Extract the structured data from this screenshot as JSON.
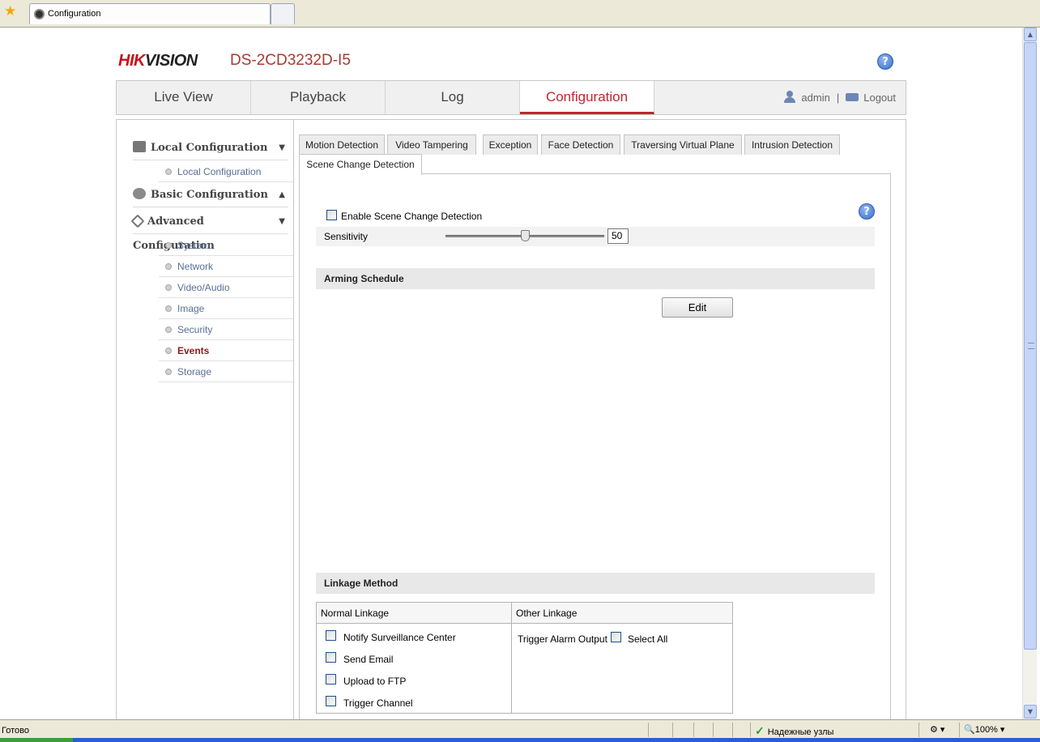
{
  "browser": {
    "tab_title": "Configuration",
    "status_text": "Готово",
    "zone_label": "Надежные узлы",
    "zoom_label": "100%"
  },
  "header": {
    "logo_hik": "HIK",
    "logo_vision": "VISION",
    "model": "DS-2CD3232D-I5",
    "help": "?"
  },
  "nav": {
    "tabs": [
      "Live View",
      "Playback",
      "Log",
      "Configuration"
    ],
    "active": "Configuration",
    "user": "admin",
    "separator": "|",
    "logout": "Logout"
  },
  "sidebar": {
    "local_config": "Local Configuration",
    "local_items": [
      "Local Configuration"
    ],
    "basic_config": "Basic Configuration",
    "advanced_config": "Advanced Configuration",
    "advanced_items": [
      "System",
      "Network",
      "Video/Audio",
      "Image",
      "Security",
      "Events",
      "Storage"
    ],
    "active_item": "Events"
  },
  "subtabs": [
    "Motion Detection",
    "Video Tampering",
    "Exception",
    "Face Detection",
    "Traversing Virtual Plane",
    "Intrusion Detection",
    "Scene Change Detection"
  ],
  "active_subtab": "Scene Change Detection",
  "panel": {
    "enable_label": "Enable Scene Change Detection",
    "enable_checked": false,
    "sensitivity_label": "Sensitivity",
    "sensitivity_value": "50",
    "sensitivity_fraction": 0.5,
    "help": "?",
    "arming_schedule": "Arming Schedule",
    "edit_label": "Edit",
    "linkage_method": "Linkage Method",
    "normal_linkage": "Normal Linkage",
    "other_linkage": "Other Linkage",
    "normal_items": [
      "Notify Surveillance Center",
      "Send Email",
      "Upload to FTP",
      "Trigger Channel"
    ],
    "trigger_alarm_output": "Trigger Alarm Output",
    "select_all": "Select All"
  }
}
